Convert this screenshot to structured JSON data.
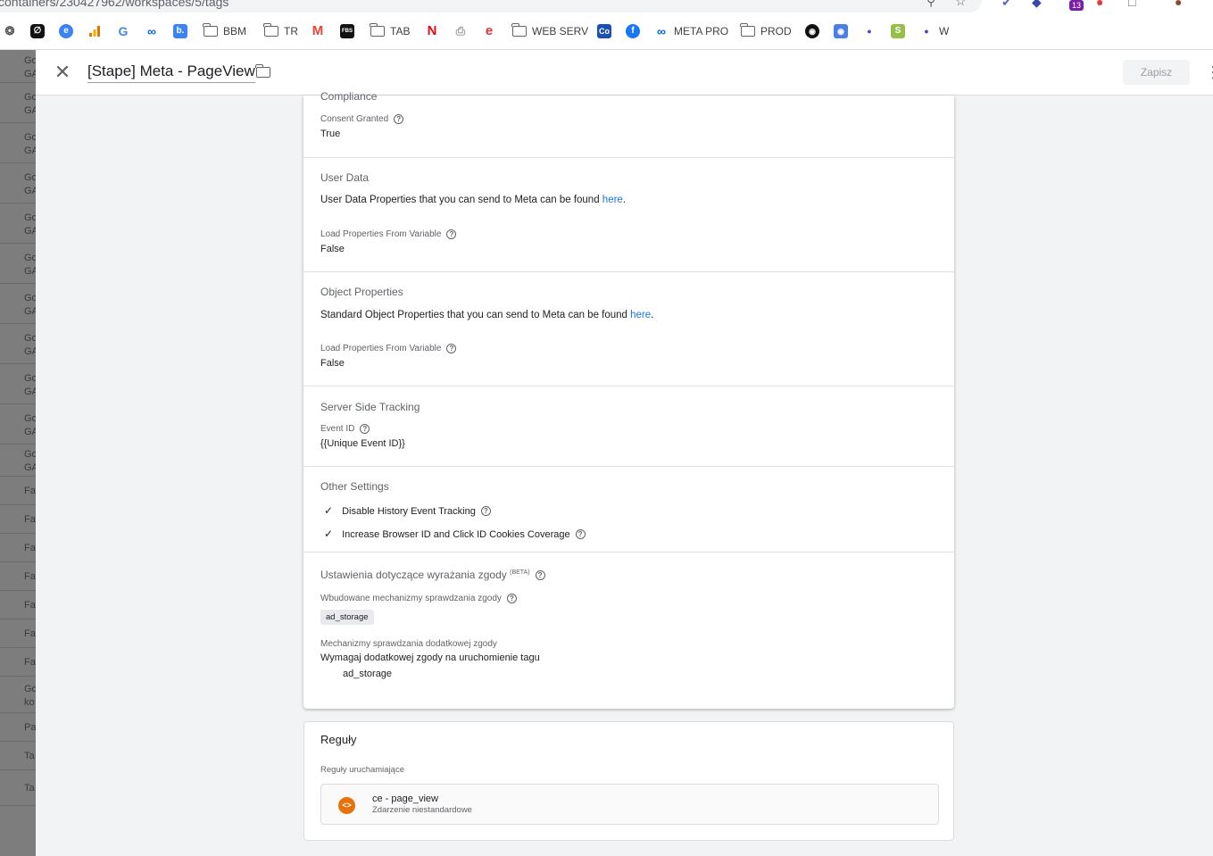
{
  "browser": {
    "url": "containers/230427962/workspaces/5/tags",
    "extension_badge": "13",
    "bookmarks": [
      {
        "icon": "chatgpt-icon",
        "label": ""
      },
      {
        "icon": "app-dark-icon",
        "label": ""
      },
      {
        "icon": "edge-icon",
        "label": ""
      },
      {
        "icon": "analytics-icon",
        "label": ""
      },
      {
        "icon": "google-icon",
        "label": ""
      },
      {
        "icon": "meta-icon",
        "label": ""
      },
      {
        "icon": "booking-icon",
        "label": ""
      },
      {
        "icon": "folder-icon",
        "label": "BBM"
      },
      {
        "icon": "folder-icon",
        "label": "TR"
      },
      {
        "icon": "gmail-icon",
        "label": ""
      },
      {
        "icon": "fbs-icon",
        "label": ""
      },
      {
        "icon": "folder-icon",
        "label": "TAB"
      },
      {
        "icon": "netflix-icon",
        "label": ""
      },
      {
        "icon": "printer-icon",
        "label": ""
      },
      {
        "icon": "e-icon",
        "label": ""
      },
      {
        "icon": "folder-icon",
        "label": "WEB SERV"
      },
      {
        "icon": "co-icon",
        "label": ""
      },
      {
        "icon": "facebook-icon",
        "label": ""
      },
      {
        "icon": "meta-icon",
        "label": "META PRO"
      },
      {
        "icon": "folder-icon",
        "label": "PROD"
      },
      {
        "icon": "github-icon",
        "label": ""
      },
      {
        "icon": "app-blue-icon",
        "label": ""
      },
      {
        "icon": "dot-icon",
        "label": ""
      },
      {
        "icon": "shopify-icon",
        "label": ""
      },
      {
        "icon": "dot-icon",
        "label": "W"
      }
    ]
  },
  "left_list": [
    "Go GA",
    "Go GA",
    "Go GA",
    "Go GA",
    "Go GA",
    "Go GA",
    "Go GA",
    "Go GA",
    "Go GA",
    "Go GA",
    "Go GA",
    "Fa",
    "Fa",
    "Fa",
    "Fa",
    "Fa",
    "Fa",
    "Fa",
    "Go ko",
    "Pa",
    "Ta",
    "Ta"
  ],
  "header": {
    "tag_name": "[Stape] Meta - PageView",
    "save_label": "Zapisz"
  },
  "compliance": {
    "title": "Compliance",
    "consent_label": "Consent Granted",
    "consent_value": "True"
  },
  "user_data": {
    "title": "User Data",
    "desc_prefix": "User Data Properties that you can send to Meta can be found ",
    "desc_link": "here",
    "desc_suffix": ".",
    "load_label": "Load Properties From Variable",
    "load_value": "False"
  },
  "object_properties": {
    "title": "Object Properties",
    "desc_prefix": "Standard Object Properties that you can send to Meta can be found ",
    "desc_link": "here",
    "desc_suffix": ".",
    "load_label": "Load Properties From Variable",
    "load_value": "False"
  },
  "server_side": {
    "title": "Server Side Tracking",
    "event_id_label": "Event ID",
    "event_id_value": "{{Unique Event ID}}"
  },
  "other_settings": {
    "title": "Other Settings",
    "checks": [
      "Disable History Event Tracking",
      "Increase Browser ID and Click ID Cookies Coverage"
    ]
  },
  "consent": {
    "title": "Ustawienia dotyczące wyrażania zgody",
    "beta": "(BETA)",
    "builtin_label": "Wbudowane mechanizmy sprawdzania zgody",
    "builtin_chip": "ad_storage",
    "additional_label": "Mechanizmy sprawdzania dodatkowej zgody",
    "additional_value": "Wymagaj dodatkowej zgody na uruchomienie tagu",
    "additional_item": "ad_storage"
  },
  "rules": {
    "title": "Reguły",
    "subtitle": "Reguły uruchamiające",
    "trigger_name": "ce - page_view",
    "trigger_type": "Zdarzenie niestandardowe",
    "trigger_icon_text": "<>"
  }
}
